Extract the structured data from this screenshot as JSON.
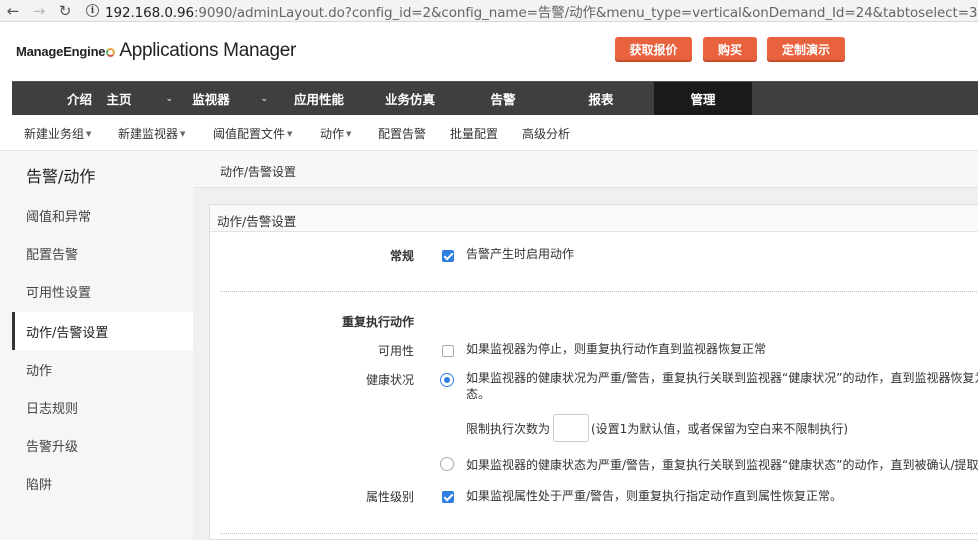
{
  "browser": {
    "url_host": "192.168.0.96",
    "url_rest": ":9090/adminLayout.do?config_id=2&config_name=告警/动作&menu_type=vertical&onDemand_Id=24&tabtoselect=3"
  },
  "header": {
    "logo_brand": "ManageEngine",
    "logo_product": "Applications Manager",
    "buttons": [
      "获取报价",
      "购买",
      "定制演示"
    ]
  },
  "mainnav": [
    {
      "label": "介绍",
      "caret": false
    },
    {
      "label": "主页",
      "caret": true
    },
    {
      "label": "监视器",
      "caret": true
    },
    {
      "label": "应用性能",
      "caret": false
    },
    {
      "label": "业务仿真",
      "caret": false
    },
    {
      "label": "告警",
      "caret": false
    },
    {
      "label": "报表",
      "caret": false
    },
    {
      "label": "管理",
      "caret": false,
      "active": true
    }
  ],
  "subnav": [
    {
      "label": "新建业务组",
      "dropdown": true
    },
    {
      "label": "新建监视器",
      "dropdown": true
    },
    {
      "label": "阈值配置文件",
      "dropdown": true
    },
    {
      "label": "动作",
      "dropdown": true
    },
    {
      "label": "配置告警",
      "dropdown": false
    },
    {
      "label": "批量配置",
      "dropdown": false
    },
    {
      "label": "高级分析",
      "dropdown": false
    }
  ],
  "sidebar": {
    "title": "告警/动作",
    "items": [
      "阈值和异常",
      "配置告警",
      "可用性设置",
      "动作/告警设置",
      "动作",
      "日志规则",
      "告警升级",
      "陷阱"
    ],
    "active_index": 3
  },
  "content": {
    "breadcrumb": "动作/告警设置",
    "panel_title": "动作/告警设置",
    "general_label": "常规",
    "general_option": "告警产生时启用动作",
    "general_checked": true,
    "repeat_heading": "重复执行动作",
    "availability_label": "可用性",
    "availability_option": "如果监视器为停止，则重复执行动作直到监视器恢复正常",
    "availability_checked": false,
    "health_label": "健康状况",
    "health_option1_line1": "如果监视器的健康状况为严重/警告，重复执行关联到监视器“健康状况”的动作，直到监视器恢复为",
    "health_option1_line2": "态。",
    "health_option1_selected": true,
    "limit_label": "限制执行次数为",
    "limit_value": "",
    "limit_hint": "(设置1为默认值，或者保留为空白来不限制执行)",
    "health_option2": "如果监视器的健康状态为严重/警告，重复执行关联到监视器“健康状态”的动作，直到被确认/提取",
    "attribute_label": "属性级别",
    "attribute_option": "如果监视属性处于严重/警告，则重复执行指定动作直到属性恢复正常。",
    "attribute_checked": true
  }
}
